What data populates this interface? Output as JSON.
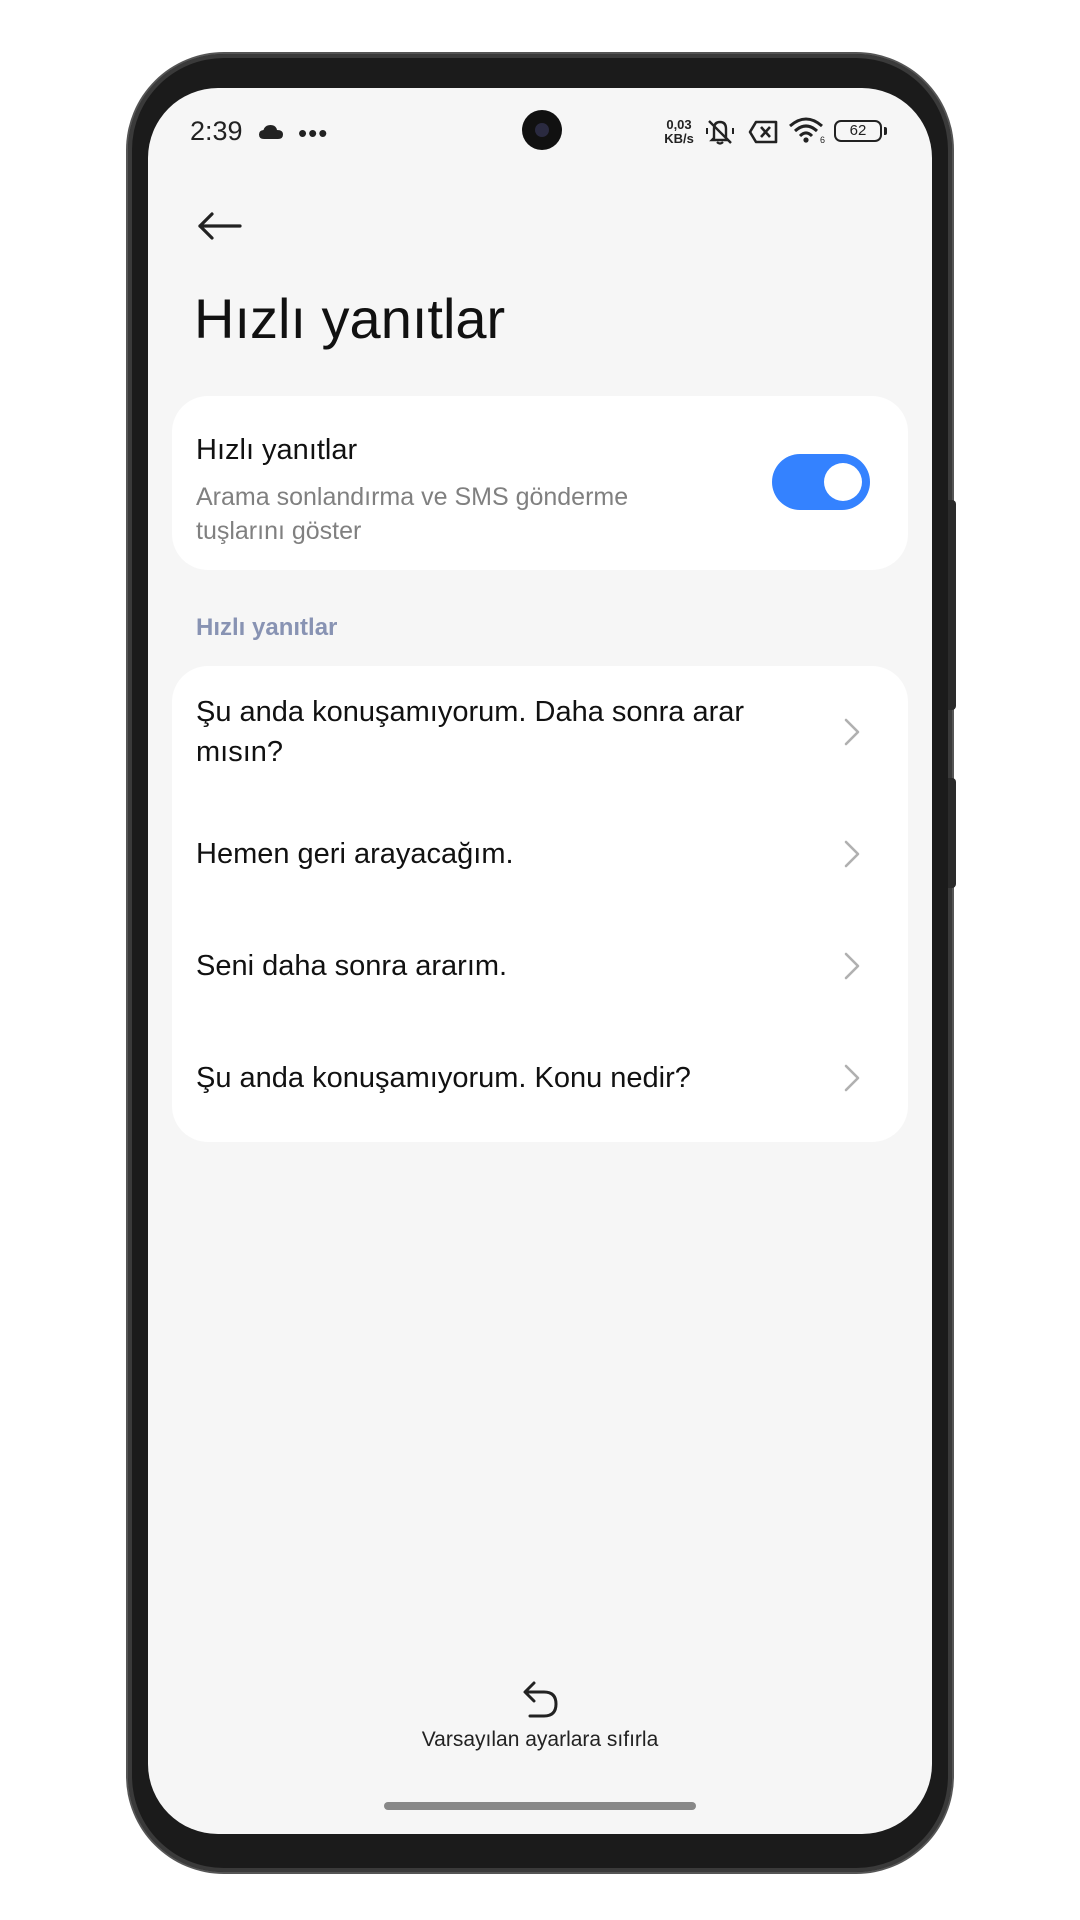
{
  "status_bar": {
    "time": "2:39",
    "net_speed_value": "0,03",
    "net_speed_unit": "KB/s",
    "battery": "62"
  },
  "header": {
    "title": "Hızlı yanıtlar"
  },
  "toggle_card": {
    "title": "Hızlı yanıtlar",
    "subtitle": "Arama sonlandırma ve SMS gönderme tuşlarını göster",
    "enabled": true,
    "accent_color": "#3482ff"
  },
  "section": {
    "header": "Hızlı yanıtlar",
    "header_color": "#8893b3"
  },
  "replies": [
    "Şu anda konuşamıyorum. Daha sonra arar mısın?",
    "Hemen geri arayacağım.",
    "Seni daha sonra ararım.",
    "Şu anda konuşamıyorum. Konu nedir?"
  ],
  "footer": {
    "reset_label": "Varsayılan ayarlara sıfırla"
  }
}
